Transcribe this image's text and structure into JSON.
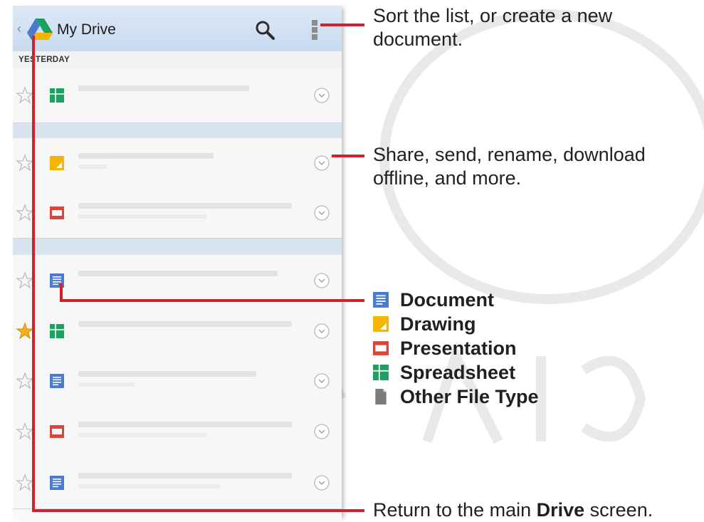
{
  "app_header": {
    "title": "My Drive",
    "back_glyph": "‹",
    "icons": [
      "drive-logo",
      "search-icon",
      "overflow-menu-icon"
    ]
  },
  "list": {
    "section_label": "YESTERDAY",
    "rows": [
      {
        "starred": false,
        "file_type": "spreadsheet"
      },
      {
        "starred": false,
        "file_type": "drawing"
      },
      {
        "starred": false,
        "file_type": "presentation"
      },
      {
        "starred": false,
        "file_type": "document"
      },
      {
        "starred": true,
        "file_type": "spreadsheet"
      },
      {
        "starred": false,
        "file_type": "document"
      },
      {
        "starred": false,
        "file_type": "presentation"
      },
      {
        "starred": false,
        "file_type": "document"
      }
    ]
  },
  "callouts": {
    "menu": "Sort the list, or create a new document.",
    "more": "Share, send, rename, download offline, and more.",
    "return_prefix": "Return to the main ",
    "return_bold": "Drive",
    "return_suffix": " screen."
  },
  "legend": [
    {
      "label": "Document",
      "icon": "document-icon"
    },
    {
      "label": "Drawing",
      "icon": "drawing-icon"
    },
    {
      "label": "Presentation",
      "icon": "presentation-icon"
    },
    {
      "label": "Spreadsheet",
      "icon": "spreadsheet-icon"
    },
    {
      "label": "Other File Type",
      "icon": "other-file-icon"
    }
  ],
  "colors": {
    "document": "#4a7bd0",
    "drawing": "#f4b400",
    "presentation": "#db4437",
    "spreadsheet": "#1ba261",
    "other": "#7c7c7c",
    "callout_line": "#d4202b",
    "header": "#c9dbf0"
  }
}
